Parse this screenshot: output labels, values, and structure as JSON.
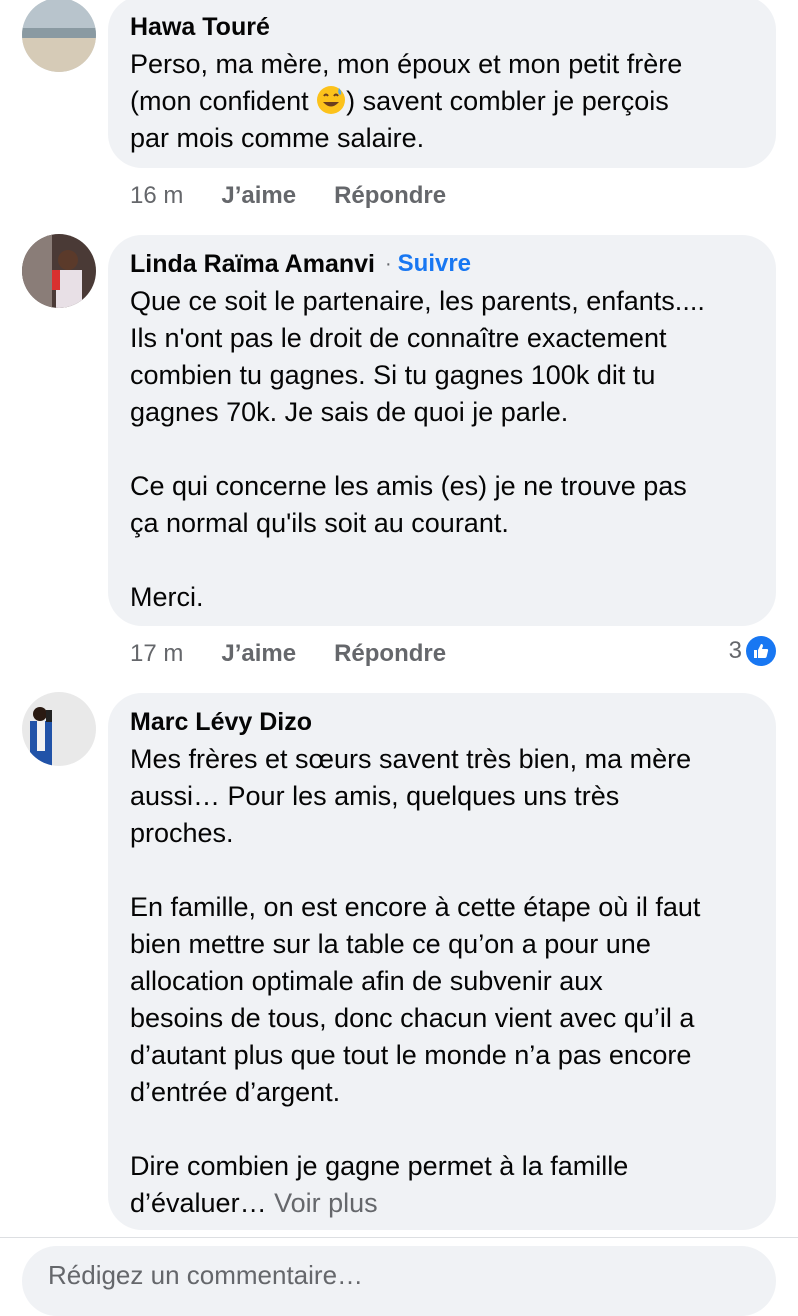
{
  "comments": [
    {
      "author": "Hawa Touré",
      "text_before_emoji": "Perso, ma mère, mon époux et mon petit frère\n(mon confident ",
      "emoji": "grinning-sweat",
      "text_after_emoji": ") savent combler je perçois\npar mois comme salaire.",
      "time": "16 m",
      "like_label": "J’aime",
      "reply_label": "Répondre"
    },
    {
      "author": "Linda Raïma Amanvi",
      "separator": "·",
      "follow_label": "Suivre",
      "text": "Que ce soit le partenaire, les parents, enfants....\nIls n'ont pas le droit de connaître exactement\ncombien tu gagnes. Si tu gagnes 100k dit tu\ngagnes 70k. Je sais de quoi je parle.\n\nCe qui concerne les amis (es) je ne trouve pas\nça normal qu'ils soit au courant.\n\nMerci.",
      "time": "17 m",
      "like_label": "J’aime",
      "reply_label": "Répondre",
      "reaction_count": "3"
    },
    {
      "author": "Marc Lévy Dizo",
      "text": "Mes frères et sœurs savent très bien, ma mère\naussi… Pour les amis, quelques uns très\nproches.\n\nEn famille, on est encore à cette étape où il faut\nbien mettre sur la table ce qu’on a pour une\nallocation optimale afin de subvenir aux\nbesoins de tous, donc chacun vient avec qu’il a\nd’autant plus que tout le monde n’a pas encore\nd’entrée d’argent.\n\nDire combien je gagne permet à la famille\nd’évaluer…",
      "see_more": "Voir plus"
    }
  ],
  "composer": {
    "placeholder": "Rédigez un commentaire…"
  },
  "colors": {
    "bubble": "#f0f2f5",
    "accent": "#1877f2",
    "muted": "#65676b"
  }
}
